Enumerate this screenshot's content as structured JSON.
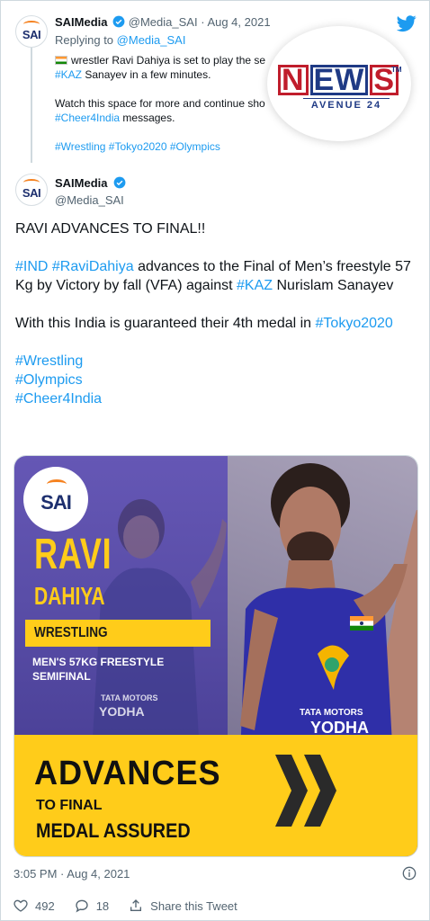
{
  "reply_tweet": {
    "author_name": "SAIMedia",
    "author_handle": "@Media_SAI",
    "separator": "·",
    "date": "Aug 4, 2021",
    "replying_to_prefix": "Replying to",
    "replying_to_handle": "@Media_SAI",
    "line1": "wrestler Ravi Dahiya is set to play the se",
    "line2_hashtag": "#KAZ",
    "line2_rest": " Sanayev in a few minutes.",
    "line3": "Watch this space for more and continue sho",
    "line4_hashtag": "#Cheer4India",
    "line4_rest": " messages.",
    "hashtags": "#Wrestling #Tokyo2020 #Olympics"
  },
  "watermark": {
    "word_n": "N",
    "word_ew": "EW",
    "word_s": "S",
    "tm": "TM",
    "subtitle": "AVENUE 24"
  },
  "main_tweet": {
    "author_name": "SAIMedia",
    "author_handle": "@Media_SAI",
    "headline": "RAVI ADVANCES TO FINAL!!",
    "para1_tag1": "#IND",
    "para1_tag2": "#RaviDahiya",
    "para1_text1": " advances to the Final of Men’s freestyle 57 Kg by Victory by fall (VFA) against ",
    "para1_tag3": "#KAZ",
    "para1_text2": "  Nurislam Sanayev",
    "para2_text": "With this India is guaranteed their 4th medal in ",
    "para2_tag": "#Tokyo2020",
    "tag_wrestling": "#Wrestling",
    "tag_olympics": "#Olympics",
    "tag_cheer": "#Cheer4India"
  },
  "poster": {
    "logo": "SAI",
    "first_name": "RAVI",
    "last_name": "DAHIYA",
    "sport": "WRESTLING",
    "event_line1": "MEN'S 57KG FREESTYLE",
    "event_line2": "SEMIFINAL",
    "advances": "ADVANCES",
    "to_final": "TO FINAL",
    "medal": "MEDAL ASSURED",
    "jersey_text1": "TATA MOTORS",
    "jersey_text2": "YODHA"
  },
  "footer": {
    "time": "3:05 PM",
    "separator": "·",
    "date": "Aug 4, 2021",
    "likes": "492",
    "replies": "18",
    "share_label": "Share this Tweet"
  },
  "colors": {
    "link": "#1d9bf0",
    "twitter_blue": "#1d9bf0",
    "poster_yellow": "#ffcc1a",
    "poster_purple": "#5a4ea8",
    "news_red": "#c01d2c",
    "news_blue": "#1f3a85"
  }
}
